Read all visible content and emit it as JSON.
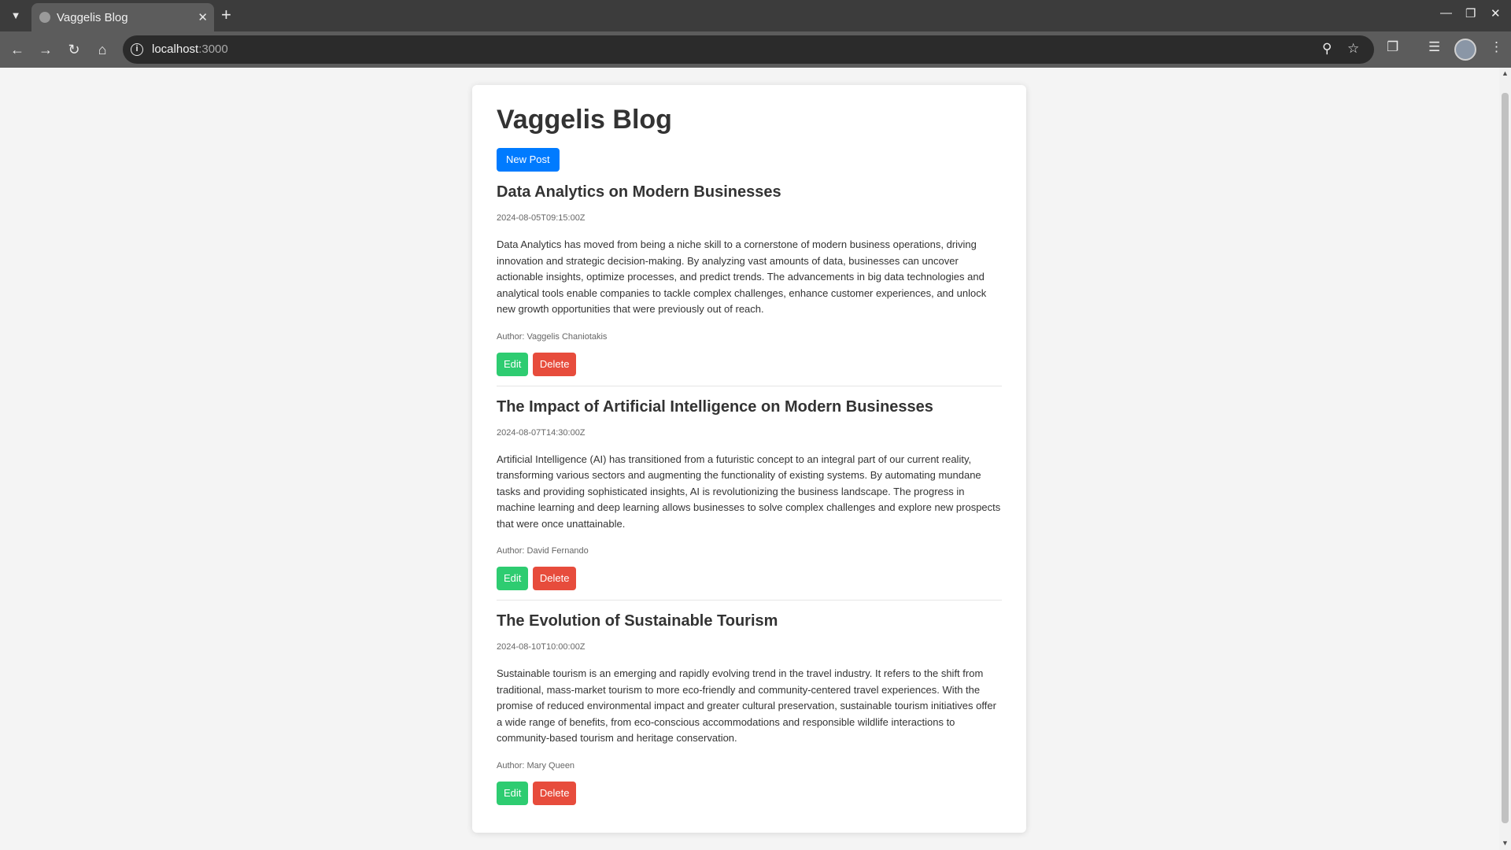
{
  "browser": {
    "tab_title": "Vaggelis Blog",
    "url_host": "localhost",
    "url_port": ":3000"
  },
  "page": {
    "title": "Vaggelis Blog",
    "new_post_label": "New Post"
  },
  "posts": [
    {
      "title": "Data Analytics on Modern Businesses",
      "date": "2024-08-05T09:15:00Z",
      "content": "Data Analytics has moved from being a niche skill to a cornerstone of modern business operations, driving innovation and strategic decision-making. By analyzing vast amounts of data, businesses can uncover actionable insights, optimize processes, and predict trends. The advancements in big data technologies and analytical tools enable companies to tackle complex challenges, enhance customer experiences, and unlock new growth opportunities that were previously out of reach.",
      "author": "Author: Vaggelis Chaniotakis",
      "edit_label": "Edit",
      "delete_label": "Delete"
    },
    {
      "title": "The Impact of Artificial Intelligence on Modern Businesses",
      "date": "2024-08-07T14:30:00Z",
      "content": "Artificial Intelligence (AI) has transitioned from a futuristic concept to an integral part of our current reality, transforming various sectors and augmenting the functionality of existing systems. By automating mundane tasks and providing sophisticated insights, AI is revolutionizing the business landscape. The progress in machine learning and deep learning allows businesses to solve complex challenges and explore new prospects that were once unattainable.",
      "author": "Author: David Fernando",
      "edit_label": "Edit",
      "delete_label": "Delete"
    },
    {
      "title": "The Evolution of Sustainable Tourism",
      "date": "2024-08-10T10:00:00Z",
      "content": "Sustainable tourism is an emerging and rapidly evolving trend in the travel industry. It refers to the shift from traditional, mass-market tourism to more eco-friendly and community-centered travel experiences. With the promise of reduced environmental impact and greater cultural preservation, sustainable tourism initiatives offer a wide range of benefits, from eco-conscious accommodations and responsible wildlife interactions to community-based tourism and heritage conservation.",
      "author": "Author: Mary Queen",
      "edit_label": "Edit",
      "delete_label": "Delete"
    }
  ],
  "colors": {
    "new_post_button": "#007bff",
    "edit_button": "#2ecc71",
    "delete_button": "#e74c3c"
  },
  "icons": {
    "tab_list": "chevron-down-icon",
    "favicon": "globe-icon",
    "tab_close": "close-icon",
    "new_tab": "plus-icon",
    "back": "back-arrow-icon",
    "forward": "forward-arrow-icon",
    "reload": "reload-icon",
    "home": "home-icon",
    "site_info": "info-icon",
    "zoom": "zoom-icon",
    "bookmark": "star-icon",
    "extensions": "puzzle-icon",
    "media": "media-control-icon",
    "profile": "avatar",
    "menu": "kebab-menu-icon"
  }
}
